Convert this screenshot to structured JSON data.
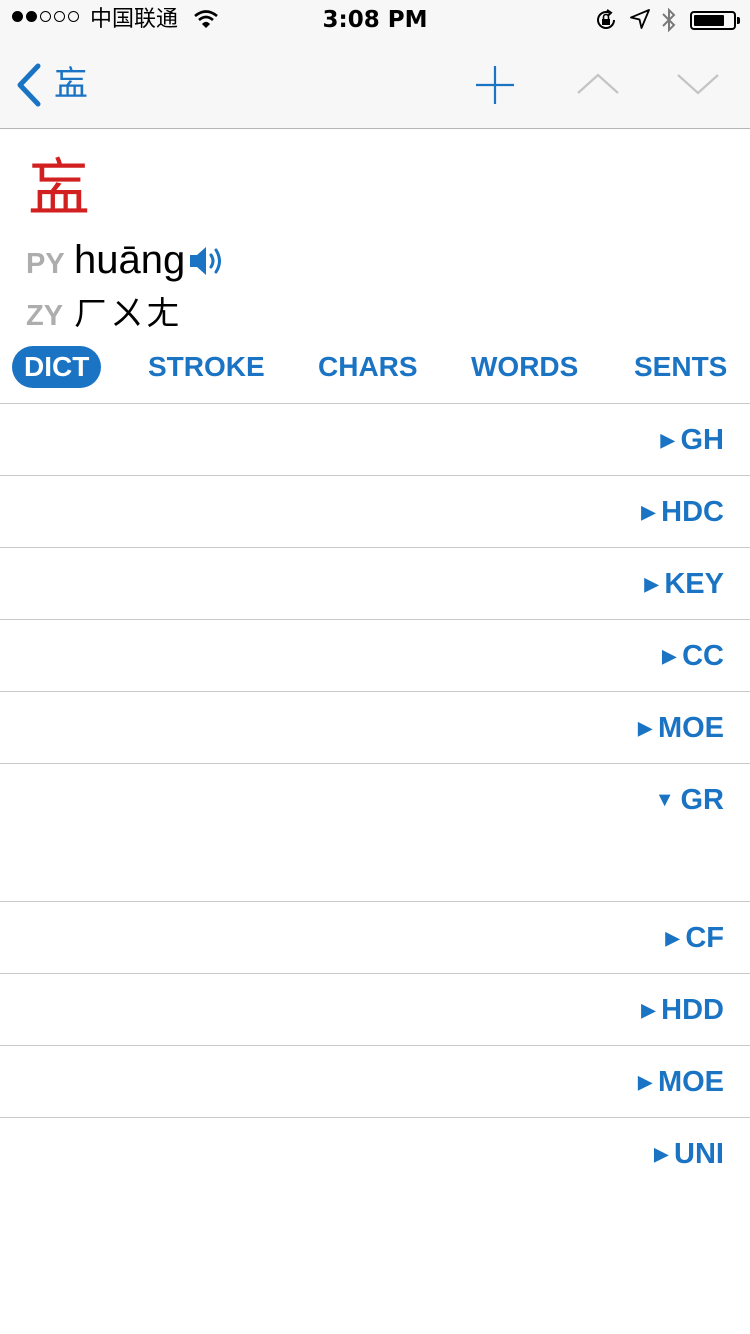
{
  "status_bar": {
    "carrier": "中国联通",
    "time": "3:08 PM",
    "signal_bars_filled": 2,
    "signal_bars_total": 5
  },
  "nav": {
    "back_label": "衁",
    "icons": [
      "back-chevron-icon",
      "add-icon",
      "chevron-up-icon",
      "chevron-down-icon"
    ]
  },
  "header": {
    "character": "衁",
    "py_label": "PY",
    "pinyin": "huāng",
    "zy_label": "ZY",
    "zhuyin": "ㄏㄨㄤ"
  },
  "tabs": [
    {
      "label": "DICT",
      "active": true
    },
    {
      "label": "STROKE",
      "active": false
    },
    {
      "label": "CHARS",
      "active": false
    },
    {
      "label": "WORDS",
      "active": false
    },
    {
      "label": "SENTS",
      "active": false
    }
  ],
  "entries": [
    {
      "label": "GH",
      "marker": "▶",
      "expanded": false
    },
    {
      "label": "HDC",
      "marker": "▶",
      "expanded": false
    },
    {
      "label": "KEY",
      "marker": "▶",
      "expanded": false
    },
    {
      "label": "CC",
      "marker": "▶",
      "expanded": false
    },
    {
      "label": "MOE",
      "marker": "▶",
      "expanded": false
    },
    {
      "label": "GR",
      "marker": "▼",
      "expanded": true
    },
    {
      "label": "CF",
      "marker": "▶",
      "expanded": false
    },
    {
      "label": "HDD",
      "marker": "▶",
      "expanded": false
    },
    {
      "label": "MOE",
      "marker": "▶",
      "expanded": false
    },
    {
      "label": "UNI",
      "marker": "▶",
      "expanded": false
    }
  ],
  "colors": {
    "accent": "#1a73c3",
    "character": "#d21f1f",
    "label_gray": "#adadad",
    "bar_bg": "#f7f7f7"
  }
}
